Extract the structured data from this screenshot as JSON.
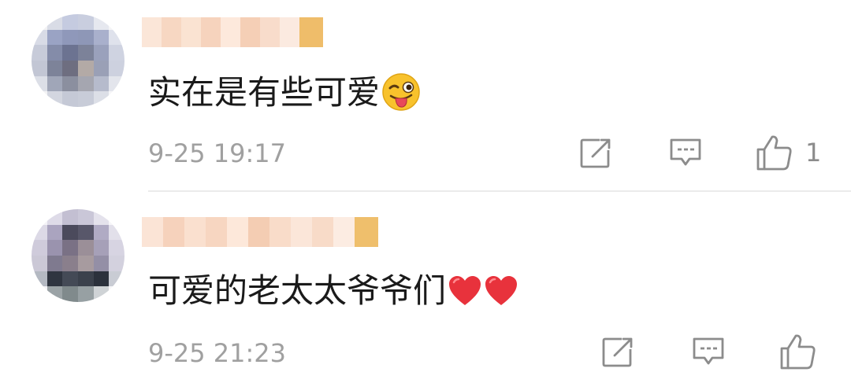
{
  "comments": [
    {
      "content": "实在是有些可爱",
      "emoji": "winking-tongue-emoji",
      "timestamp": "9-25 19:17",
      "like_count": "1",
      "icons": [
        "share-icon",
        "reply-icon",
        "like-icon"
      ]
    },
    {
      "content": "可爱的老太太爷爷们",
      "emoji": "red-heart-emoji",
      "timestamp": "9-25 21:23",
      "like_count": "",
      "icons": [
        "share-icon",
        "reply-icon",
        "like-icon"
      ]
    }
  ],
  "colors": {
    "text": "#1a1a1a",
    "meta": "#a0a0a0",
    "icon": "#8c8c8c",
    "divider": "#ebebeb",
    "heart": "#e8323c",
    "emoji_face": "#f8c22c"
  }
}
